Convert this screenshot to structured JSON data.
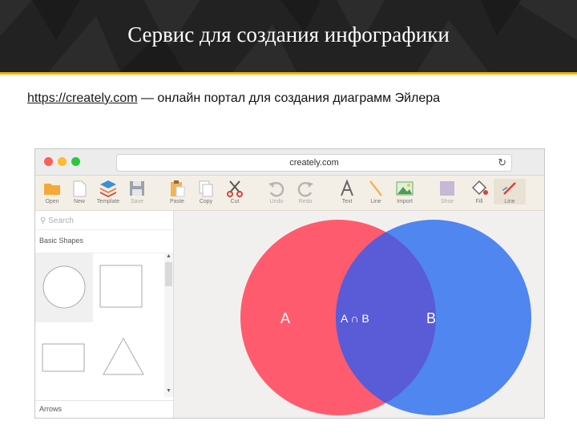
{
  "slide": {
    "title": "Сервис для создания инфографики",
    "subtitle_link": "https://creately.com",
    "subtitle_rest": " — онлайн портал для создания диаграмм Эйлера"
  },
  "browser": {
    "url": "creately.com",
    "reload_glyph": "↻"
  },
  "toolbar": {
    "tools": [
      {
        "label": "Open",
        "icon": "folder-icon"
      },
      {
        "label": "New",
        "icon": "new-document-icon"
      },
      {
        "label": "Template",
        "icon": "template-icon"
      },
      {
        "label": "Save",
        "icon": "save-icon"
      },
      {
        "label": "Paste",
        "icon": "paste-icon"
      },
      {
        "label": "Copy",
        "icon": "copy-icon"
      },
      {
        "label": "Cut",
        "icon": "scissors-icon"
      },
      {
        "label": "Undo",
        "icon": "undo-icon"
      },
      {
        "label": "Redo",
        "icon": "redo-icon"
      },
      {
        "label": "Text",
        "icon": "text-icon"
      },
      {
        "label": "Line",
        "icon": "line-icon"
      },
      {
        "label": "Import",
        "icon": "image-icon"
      },
      {
        "label": "Shse",
        "icon": "shape-fill-icon"
      },
      {
        "label": "Fill",
        "icon": "fill-bucket-icon"
      },
      {
        "label": "Line",
        "icon": "line-color-icon"
      }
    ]
  },
  "sidebar": {
    "search_placeholder": "Search",
    "section": "Basic Shapes",
    "footer_section": "Arrows",
    "shapes": [
      "circle-shape",
      "square-shape",
      "rectangle-shape",
      "triangle-shape"
    ]
  },
  "venn": {
    "left_label": "A",
    "intersection_label": "A ∩ B",
    "right_label": "B",
    "colors": {
      "left": "#ff5b6e",
      "right": "#4f86ef",
      "overlap": "#5a5bd6"
    }
  }
}
